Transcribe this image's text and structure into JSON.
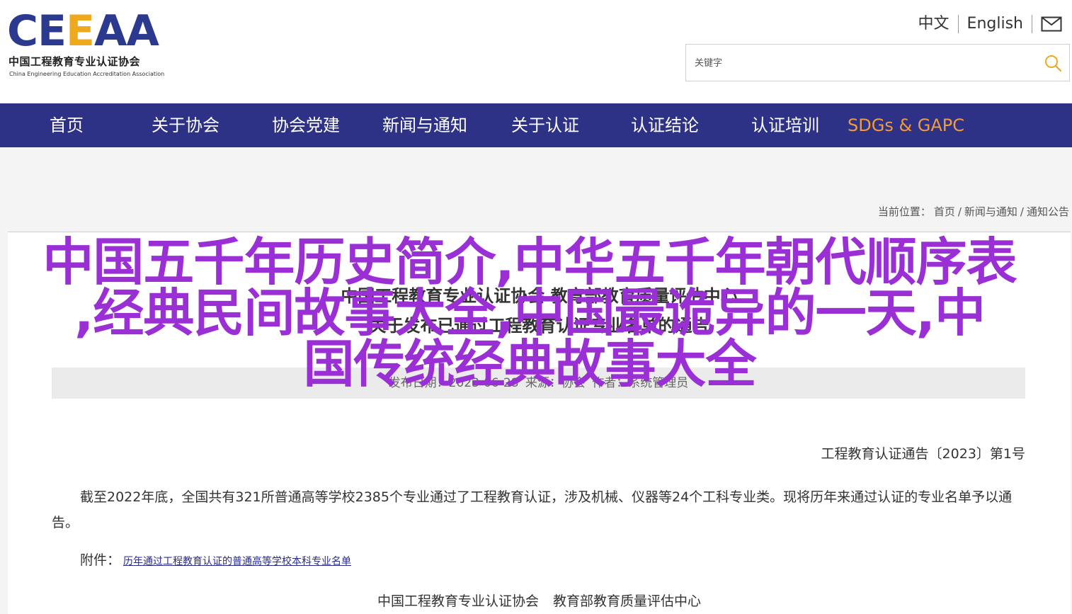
{
  "header": {
    "logo_mark_1": "CE",
    "logo_mark_2": "E",
    "logo_mark_3": "AA",
    "logo_cn": "中国工程教育专业认证协会",
    "logo_en": "China Engineering Education Accreditation Association",
    "lang_cn": "中文",
    "lang_en": "English",
    "search_placeholder": "关键字"
  },
  "nav": {
    "items": [
      {
        "label": "首页"
      },
      {
        "label": "关于协会"
      },
      {
        "label": "协会党建"
      },
      {
        "label": "新闻与通知"
      },
      {
        "label": "关于认证"
      },
      {
        "label": "认证结论"
      },
      {
        "label": "认证培训"
      },
      {
        "label": "SDGs & GAPC"
      }
    ]
  },
  "breadcrumb": {
    "prefix": "当前位置：",
    "items": [
      "首页",
      "新闻与通知",
      "通知公告"
    ],
    "separator": "/"
  },
  "article": {
    "title_line1": "中国工程教育专业认证协会 教育部教育质量评估中心",
    "title_line2": "关于发布已通过工程教育认证专业名单的通告",
    "meta_date": "发布日期：2023-06-28",
    "meta_source": "来源：协会",
    "meta_author": "作者：系统管理员",
    "notice_no": "工程教育认证通告〔2023〕第1号",
    "paragraph": "截至2022年底，全国共有321所普通高等学校2385个专业通过了工程教育认证，涉及机械、仪器等24个工科专业类。现将历年来通过认证的专业名单予以通告。",
    "attachment_label": "附件：",
    "attachment_link": "历年通过工程教育认证的普通高等学校本科专业名单",
    "signer_1": "中国工程教育专业认证协会",
    "signer_2": "教育部教育质量评估中心"
  },
  "overlay": {
    "line1": "中国五千年历史简介,中华五千年朝代顺序表",
    "line2": ",经典民间故事大全,中国最诡异的一天,中",
    "line3": "国传统经典故事大全"
  },
  "colors": {
    "nav_bg": "#2d3286",
    "nav_accent": "#f39b3a",
    "overlay_text": "#9a2fd6",
    "logo_blue": "#2b3a8f",
    "logo_orange": "#f0a81c"
  }
}
